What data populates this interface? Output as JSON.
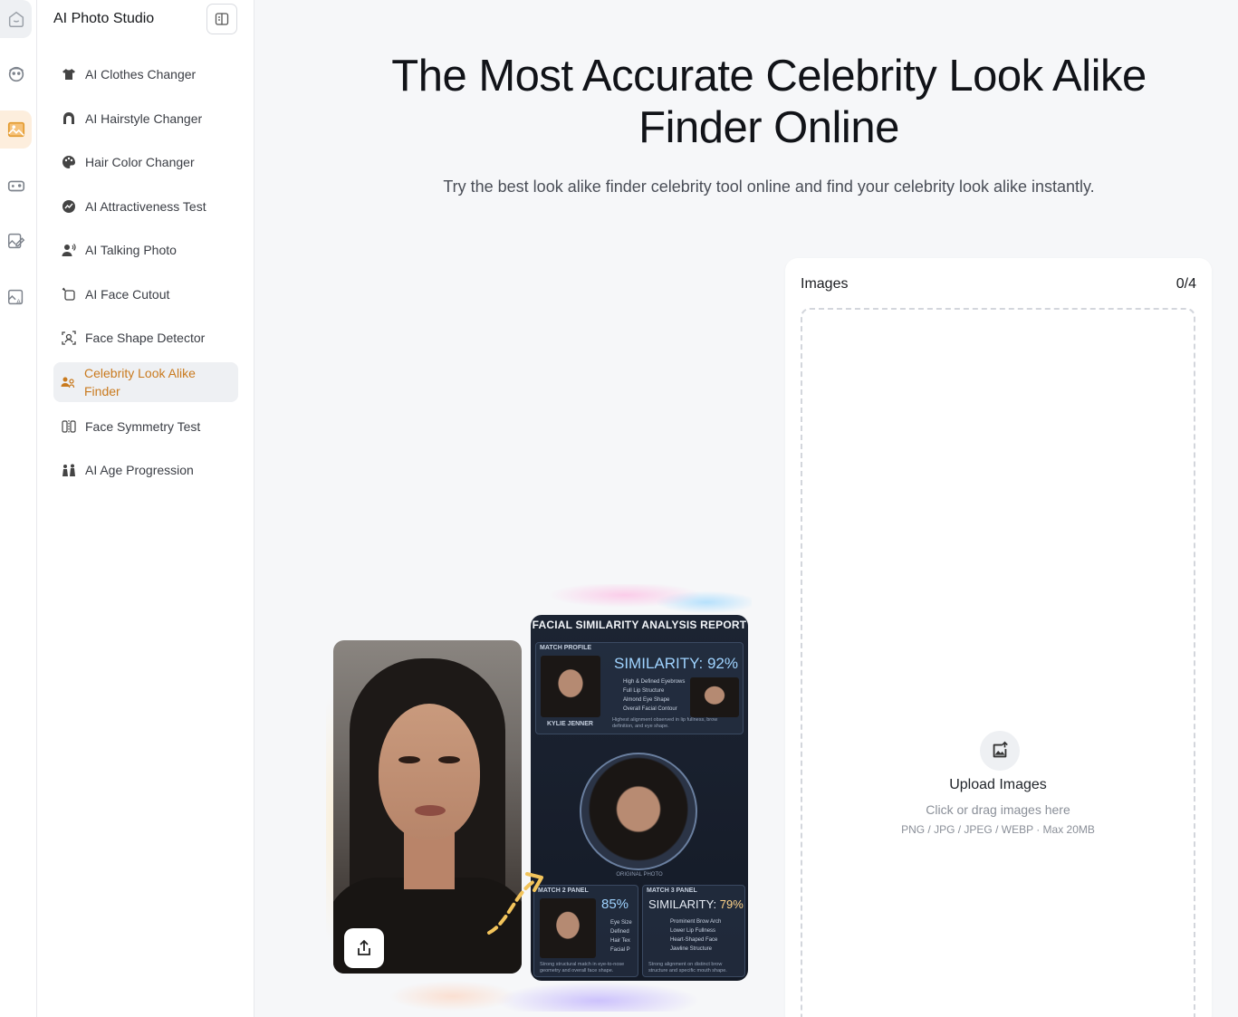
{
  "sidebar": {
    "title": "AI Photo Studio",
    "items": [
      {
        "label": "AI Clothes Changer",
        "icon": "shirt-icon"
      },
      {
        "label": "AI Hairstyle Changer",
        "icon": "hairstyle-icon"
      },
      {
        "label": "Hair Color Changer",
        "icon": "palette-icon"
      },
      {
        "label": "AI Attractiveness Test",
        "icon": "face-rating-icon"
      },
      {
        "label": "AI Talking Photo",
        "icon": "talking-person-icon"
      },
      {
        "label": "AI Face Cutout",
        "icon": "crop-icon"
      },
      {
        "label": "Face Shape Detector",
        "icon": "face-scan-icon"
      },
      {
        "label": "Celebrity Look Alike Finder",
        "icon": "people-match-icon",
        "active": true
      },
      {
        "label": "Face Symmetry Test",
        "icon": "symmetry-icon"
      },
      {
        "label": "AI Age Progression",
        "icon": "age-icon"
      }
    ]
  },
  "rail": {
    "icons": [
      "home-smile-icon",
      "avatar-face-icon",
      "image-icon",
      "game-controller-icon",
      "edit-image-icon",
      "ai-image-icon"
    ],
    "active_index": 2
  },
  "hero": {
    "title": "The Most Accurate Celebrity Look Alike Finder Online",
    "subtitle": "Try the best look alike finder celebrity tool online and find your celebrity look alike instantly."
  },
  "sample": {
    "report_title": "FACIAL SIMILARITY ANALYSIS REPORT",
    "match_profile_label": "MATCH PROFILE",
    "match_profile_name": "KYLIE JENNER",
    "match_profile_similarity": "SIMILARITY: 92%",
    "match_profile_features": [
      "High & Defined Eyebrows",
      "Full Lip Structure",
      "Almond Eye Shape",
      "Overall Facial Contour"
    ],
    "match_profile_note": "Highest alignment observed in lip fullness, brow definition, and eye shape.",
    "original_label": "ORIGINAL PHOTO",
    "match2_label": "MATCH 2 PANEL",
    "match2_similarity": "85%",
    "match2_features": [
      "Eye Size",
      "Defined",
      "Hair Tex",
      "Facial P"
    ],
    "match2_note": "Strong structural match in eye-to-nose geometry and overall face shape.",
    "match3_label": "MATCH 3 PANEL",
    "match3_similarity_prefix": "SIMILARITY:",
    "match3_similarity_value": "79%",
    "match3_features": [
      "Prominent Brow Arch",
      "Lower Lip Fullness",
      "Heart-Shaped Face",
      "Jawline Structure"
    ],
    "match3_note": "Strong alignment on distinct brow structure and specific mouth shape."
  },
  "upload": {
    "title": "Images",
    "count": "0/4",
    "button_label": "Upload Images",
    "hint": "Click or drag images here",
    "formats": "PNG / JPG / JPEG / WEBP · Max 20MB"
  },
  "colors": {
    "accent": "#c97a1e",
    "active_bg": "#eef0f3",
    "rail_active_bg": "#fdeedd",
    "page_bg": "#f6f7f9"
  }
}
